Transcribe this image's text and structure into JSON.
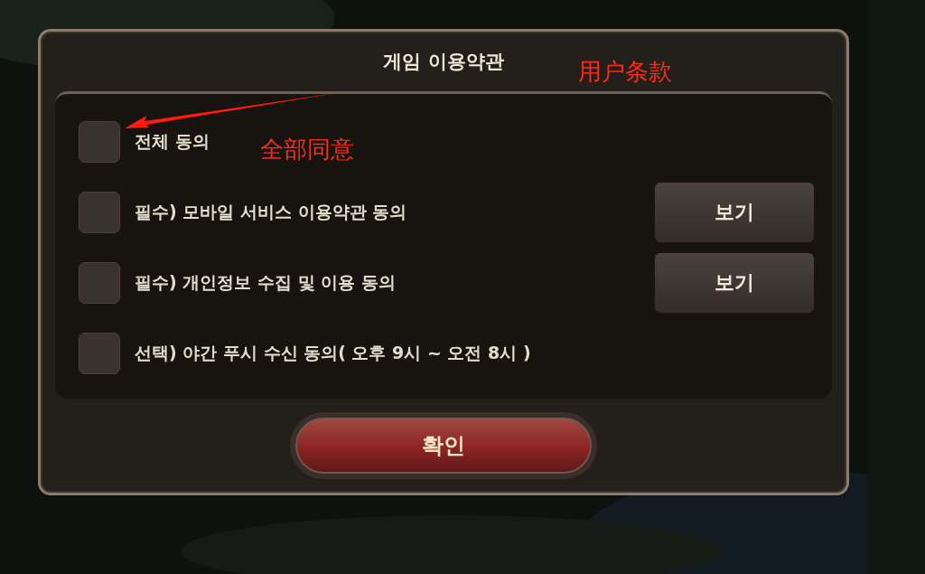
{
  "dialog": {
    "title": "게임 이용약관",
    "items": [
      {
        "label": "전체 동의",
        "checked": false
      },
      {
        "label": "필수) 모바일 서비스 이용약관 동의",
        "checked": false,
        "button": "보기"
      },
      {
        "label": "필수) 개인정보 수집 및 이용 동의",
        "checked": false,
        "button": "보기"
      },
      {
        "label": "선택) 야간 푸시 수신 동의( 오후 9시 ~ 오전 8시 )",
        "checked": false
      }
    ],
    "confirm": "확인"
  },
  "annotations": [
    {
      "kind": "title-note",
      "text": "用户条款"
    },
    {
      "kind": "item-note",
      "text": "全部同意"
    }
  ]
}
